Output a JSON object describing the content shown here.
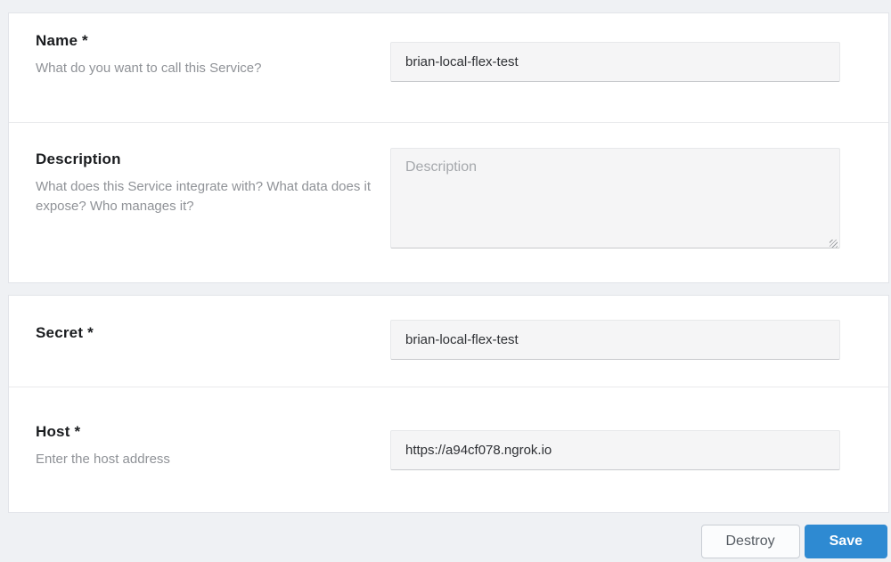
{
  "fields": {
    "name": {
      "label": "Name *",
      "helper": "What do you want to call this Service?",
      "value": "brian-local-flex-test"
    },
    "description": {
      "label": "Description",
      "helper": "What does this Service integrate with? What data does it expose? Who manages it?",
      "placeholder": "Description"
    },
    "secret": {
      "label": "Secret *",
      "value": "brian-local-flex-test"
    },
    "host": {
      "label": "Host *",
      "helper": "Enter the host address",
      "value": "https://a94cf078.ngrok.io"
    }
  },
  "footer": {
    "destroy_label": "Destroy",
    "save_label": "Save"
  },
  "colors": {
    "accent_blue": "#2e8ad2",
    "page_background": "#eff1f4",
    "input_background": "#f5f5f6"
  }
}
